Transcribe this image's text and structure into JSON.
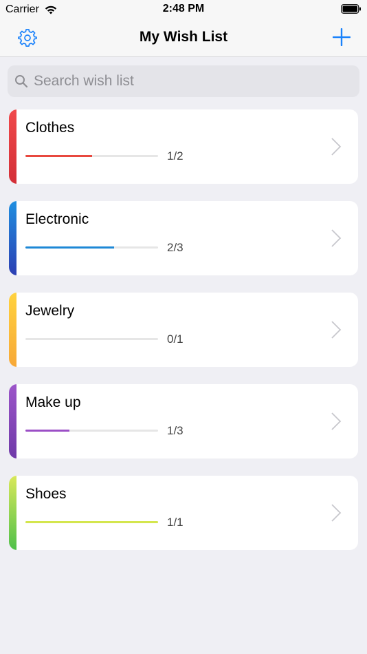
{
  "status_bar": {
    "carrier": "Carrier",
    "time": "2:48 PM"
  },
  "nav": {
    "title": "My Wish List",
    "settings_icon": "gear-icon",
    "add_icon": "plus-icon"
  },
  "search": {
    "placeholder": "Search wish list",
    "icon": "search-icon"
  },
  "lists": [
    {
      "name": "Clothes",
      "progress": "1/2",
      "done": 1,
      "total": 2,
      "color_top": "#f0494b",
      "color_bottom": "#d32f37",
      "bar_color": "#e8483f"
    },
    {
      "name": "Electronic",
      "progress": "2/3",
      "done": 2,
      "total": 3,
      "color_top": "#1f8fe0",
      "color_bottom": "#2c3fb3",
      "bar_color": "#1e88d6"
    },
    {
      "name": "Jewelry",
      "progress": "0/1",
      "done": 0,
      "total": 1,
      "color_top": "#ffd23e",
      "color_bottom": "#f7a838",
      "bar_color": "#f6b93b"
    },
    {
      "name": "Make up",
      "progress": "1/3",
      "done": 1,
      "total": 3,
      "color_top": "#9c55c9",
      "color_bottom": "#6f3aa8",
      "bar_color": "#9b4fc6"
    },
    {
      "name": "Shoes",
      "progress": "1/1",
      "done": 1,
      "total": 1,
      "color_top": "#d9e85a",
      "color_bottom": "#4fc04a",
      "bar_color": "#d4e64e"
    }
  ],
  "accent_color": "#1a82fb"
}
